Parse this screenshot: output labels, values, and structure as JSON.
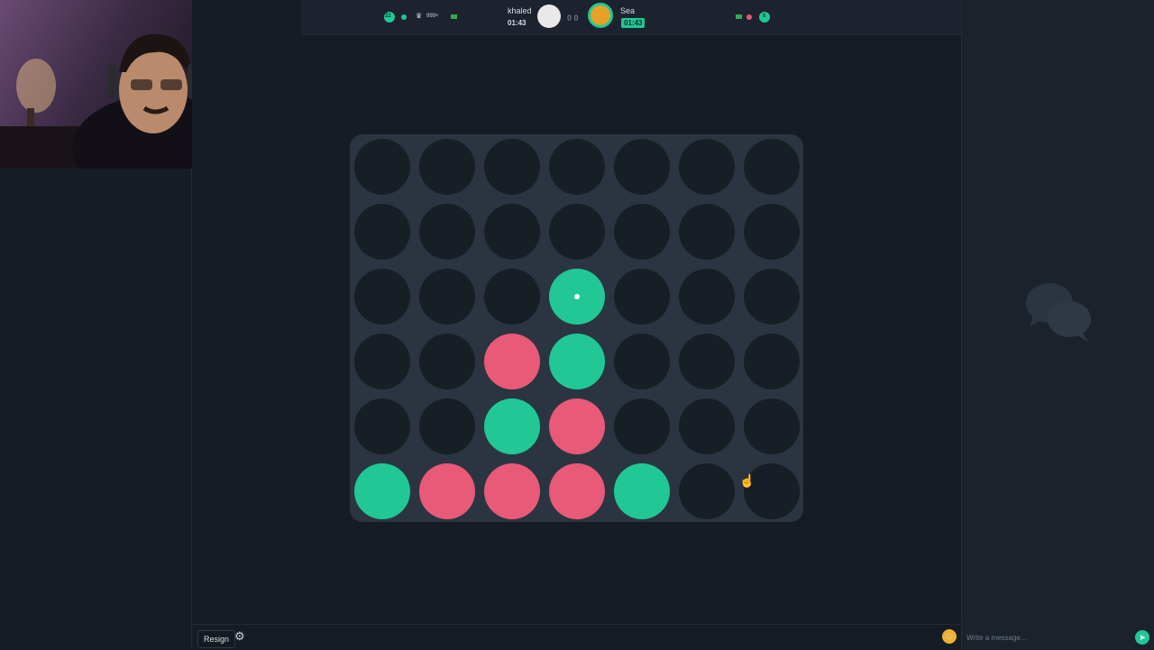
{
  "top": {
    "left_badge": "22",
    "left_count": "999+",
    "right_badge": "8",
    "player1": {
      "name": "khaled",
      "timer": "01:43"
    },
    "score": "0 0",
    "player2": {
      "name": "Sea",
      "timer": "01:43"
    }
  },
  "board": {
    "rows": 6,
    "cols": 7,
    "grid": [
      [
        "",
        "",
        "",
        "",
        "",
        "",
        ""
      ],
      [
        "",
        "",
        "",
        "",
        "",
        "",
        ""
      ],
      [
        "",
        "",
        "",
        "g",
        "",
        "",
        ""
      ],
      [
        "",
        "",
        "r",
        "g",
        "",
        "",
        ""
      ],
      [
        "",
        "",
        "g",
        "r",
        "",
        "",
        ""
      ],
      [
        "g",
        "r",
        "r",
        "r",
        "g",
        "",
        ""
      ]
    ],
    "last_move": [
      2,
      3
    ],
    "colors": {
      "green": "#21c896",
      "red": "#e85a78",
      "empty": "#181e26"
    }
  },
  "bottom": {
    "resign_label": "Resign",
    "message_placeholder": "Write a message..."
  },
  "icons": {
    "gear": "gear-icon",
    "emoji": "emoji-icon",
    "send": "send-icon",
    "chat": "chat-bubbles-icon",
    "crown": "crown-icon"
  }
}
